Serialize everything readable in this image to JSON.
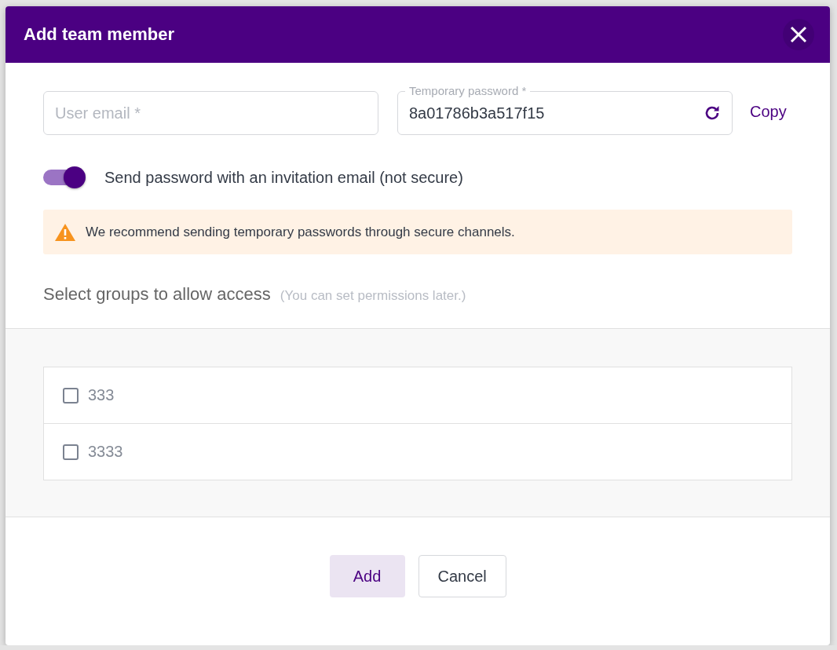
{
  "dialog": {
    "title": "Add team member"
  },
  "email_field": {
    "placeholder": "User email *"
  },
  "password_field": {
    "label": "Temporary password *",
    "value": "8a01786b3a517f15"
  },
  "copy_link": "Copy",
  "send_toggle": {
    "label": "Send password with an invitation email (not secure)",
    "on": true
  },
  "alert": {
    "text": "We recommend sending temporary passwords through secure channels."
  },
  "groups_section": {
    "title": "Select groups to allow access",
    "hint": "(You can set permissions later.)"
  },
  "groups": [
    {
      "name": "333",
      "checked": false
    },
    {
      "name": "3333",
      "checked": false
    }
  ],
  "buttons": [
    {
      "label": "Add",
      "kind": "primary"
    },
    {
      "label": "Cancel",
      "kind": "secondary"
    }
  ]
}
